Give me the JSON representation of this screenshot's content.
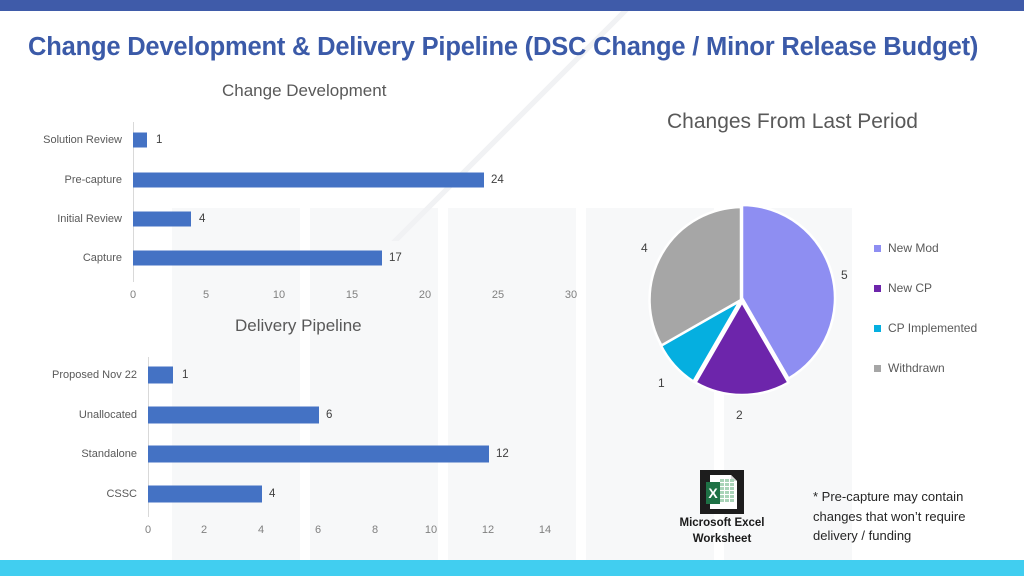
{
  "slide": {
    "title": "Change Development & Delivery Pipeline (DSC Change / Minor Release Budget)",
    "title_color": "#3b5aa8",
    "top_band_color": "#3f5ba9",
    "bottom_band_color": "#41cef0"
  },
  "footnote": {
    "text": "* Pre-capture may contain changes that won’t require delivery / funding"
  },
  "embedded_object": {
    "caption_line1": "Microsoft Excel",
    "caption_line2": "Worksheet",
    "icon_name": "excel-worksheet-icon",
    "icon_letter": "X"
  },
  "chart_data": [
    {
      "id": "change_development",
      "type": "bar",
      "orientation": "horizontal",
      "title": "Change Development",
      "categories": [
        "Capture",
        "Initial Review",
        "Pre-capture",
        "Solution Review"
      ],
      "values": [
        17,
        4,
        24,
        1
      ],
      "bar_color": "#4472c4",
      "xlabel": "",
      "ylabel": "",
      "xlim": [
        0,
        32
      ],
      "xticks": [
        0,
        5,
        10,
        15,
        20,
        25,
        30
      ],
      "grid": false,
      "legend": "none"
    },
    {
      "id": "delivery_pipeline",
      "type": "bar",
      "orientation": "horizontal",
      "title": "Delivery Pipeline",
      "categories": [
        "CSSC",
        "Standalone",
        "Unallocated",
        "Proposed Nov 22"
      ],
      "values": [
        4,
        12,
        6,
        1
      ],
      "bar_color": "#4472c4",
      "xlabel": "",
      "ylabel": "",
      "xlim": [
        0,
        15.5
      ],
      "xticks": [
        0,
        2,
        4,
        6,
        8,
        10,
        12,
        14
      ],
      "grid": false,
      "legend": "none"
    },
    {
      "id": "changes_from_last_period",
      "type": "pie",
      "title": "Changes From Last Period",
      "labels": [
        "New Mod",
        "New CP",
        "CP Implemented",
        "Withdrawn"
      ],
      "values": [
        5,
        2,
        1,
        4
      ],
      "colors": [
        "#8e8ef2",
        "#6d25ab",
        "#05afe0",
        "#a6a6a6"
      ],
      "legend": "right",
      "data_labels": [
        "5",
        "2",
        "1",
        "4"
      ]
    }
  ]
}
